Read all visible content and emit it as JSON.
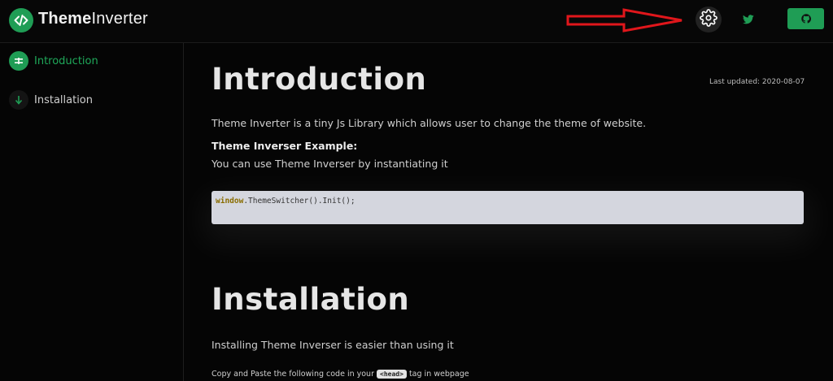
{
  "header": {
    "brand_bold": "Theme",
    "brand_light": "Inverter",
    "icons": {
      "logo": "code-icon",
      "settings": "gear-icon",
      "twitter": "twitter-icon",
      "github": "github-icon"
    },
    "annotation": "red-arrow-pointing-to-settings"
  },
  "sidebar": {
    "items": [
      {
        "label": "Introduction",
        "active": true,
        "icon": "list-icon"
      },
      {
        "label": "Installation",
        "active": false,
        "icon": "arrow-down-icon"
      }
    ]
  },
  "main": {
    "intro": {
      "title": "Introduction",
      "last_updated": "Last updated: 2020-08-07",
      "description": "Theme Inverter is a tiny Js Library which allows user to change the theme of website.",
      "example_heading": "Theme Inverser Example:",
      "example_text": "You can use Theme Inverser by instantiating it",
      "code_keyword": "window",
      "code_rest": ".ThemeSwitcher().Init();"
    },
    "install": {
      "title": "Installation",
      "description": "Installing Theme Inverser is easier than using it",
      "note_before": "Copy and Paste the following code in your",
      "note_tag": "<head>",
      "note_after": "tag in webpage"
    }
  },
  "colors": {
    "accent": "#1f9d55",
    "background": "#050505",
    "annotation_red": "#e0161b",
    "code_bg": "#d4d6de"
  }
}
